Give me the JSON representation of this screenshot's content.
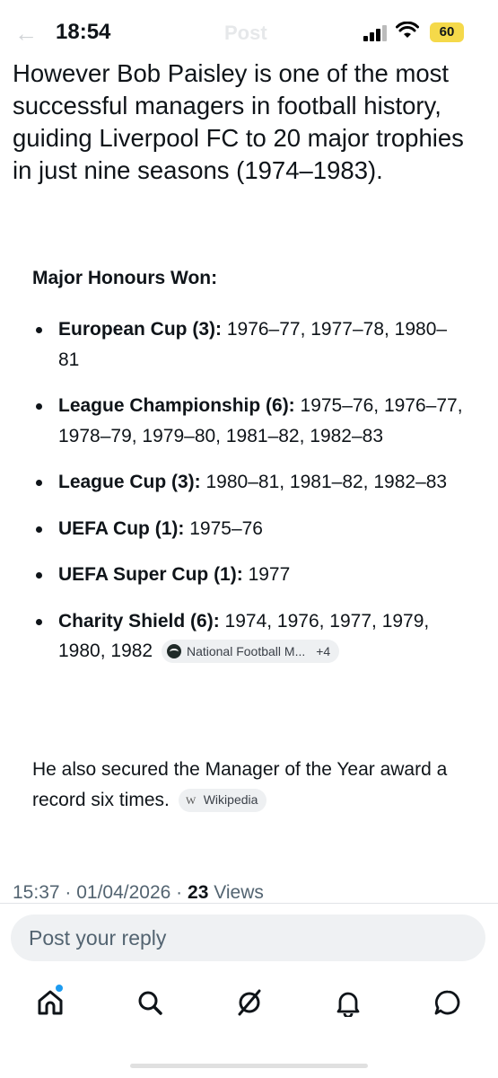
{
  "status_bar": {
    "time": "18:54",
    "battery": "60",
    "header_ghost": "Post"
  },
  "post": {
    "intro": "However Bob Paisley is one of the most successful managers in football history, guiding Liverpool FC to 20 major trophies in just nine seasons (1974–1983).",
    "honours_heading": "Major Honours Won:",
    "honours": [
      {
        "name": "European Cup (3):",
        "years": " 1976–77, 1977–78, 1980–81"
      },
      {
        "name": "League Championship (6):",
        "years": " 1975–76, 1976–77, 1978–79, 1979–80, 1981–82, 1982–83"
      },
      {
        "name": "League Cup (3):",
        "years": " 1980–81, 1981–82, 1982–83"
      },
      {
        "name": "UEFA Cup (1):",
        "years": " 1975–76"
      },
      {
        "name": "UEFA Super Cup (1):",
        "years": " 1977"
      },
      {
        "name": "Charity Shield (6):",
        "years": " 1974, 1976, 1977, 1979, 1980, 1982"
      }
    ],
    "source_chip": {
      "label": "National Football M...",
      "more": "+4"
    },
    "outro": "He also secured the Manager of the Year award a record six times.",
    "wiki_chip": {
      "icon": "W",
      "label": "Wikipedia"
    },
    "meta": {
      "time": "15:37",
      "date": "01/04/2026",
      "views_count": "23",
      "views_label": "Views"
    }
  },
  "reply": {
    "placeholder": "Post your reply"
  },
  "tabs": [
    {
      "name": "home",
      "icon": "home-icon"
    },
    {
      "name": "search",
      "icon": "search-icon"
    },
    {
      "name": "grok",
      "icon": "grok-icon"
    },
    {
      "name": "notifications",
      "icon": "bell-icon"
    },
    {
      "name": "messages",
      "icon": "message-icon"
    }
  ]
}
